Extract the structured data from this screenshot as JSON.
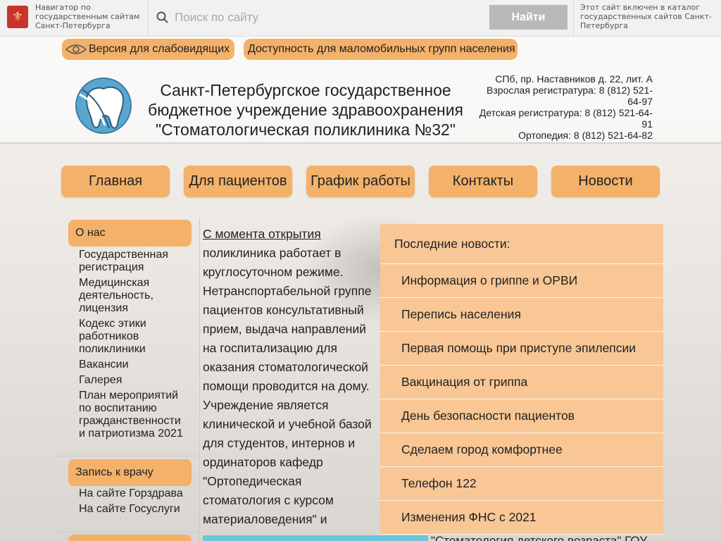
{
  "govbar": {
    "navigator_text": "Навигатор по государственным сайтам Санкт-Петербурга",
    "search_placeholder": "Поиск по сайту",
    "search_button": "Найти",
    "catalog_text": "Этот сайт включен в каталог государственных сайтов Санкт-Петербурга"
  },
  "accessibility": {
    "vision_label": "Версия для слабовидящих",
    "mobility_label": "Доступность для маломобильных групп населения"
  },
  "header": {
    "org_line1": "Санкт-Петербургское государственное",
    "org_line2": "бюджетное учреждение здравоохранения",
    "org_line3": "\"Стоматологическая поликлиника №32\"",
    "address": "СПб, пр. Наставников д. 22, лит. А",
    "adult_reg": "Взрослая регистратура: 8 (812) 521-64-97",
    "child_reg": "Детская регистратура: 8 (812) 521-64-91",
    "ortho": "Ортопедия: 8 (812) 521-64-82"
  },
  "nav": [
    "Главная",
    "Для пациентов",
    "График работы",
    "Контакты",
    "Новости"
  ],
  "sidebar": {
    "about_head": "О нас",
    "about_links": [
      "Государственная регистрация",
      "Медицинская деятельность, лицензия",
      "Кодекс этики работников поликлиники",
      "Вакансии",
      "Галерея",
      "План мероприятий по воспитанию гражданственности и патриотизма 2021"
    ],
    "appointment_head": "Запись к врачу",
    "appointment_links": [
      "На сайте Горздрава",
      "На сайте Госуслуги"
    ]
  },
  "main": {
    "lead": "С момента открытия",
    "body": "поликлиника работает в круглосуточном режиме. Нетранспортабельной группе пациентов консультативный прием, выдача направлений на госпитализацию для оказания стоматологической помощи проводится на дому. Учреждение является клинической и учебной базой для студентов, интернов и ординаторов кафедр \"Ортопедическая стоматология с курсом материаловедения\" и",
    "tail": "\"Стоматология детского возраста\" ГОУ"
  },
  "news": {
    "title": "Последние новости:",
    "items": [
      "Информация о гриппе и ОРВИ",
      "Перепись населения",
      "Первая помощь при приступе эпилепсии",
      "Вакцинация от гриппа",
      "День безопасности пациентов",
      "Сделаем город комфортнее",
      "Телефон 122",
      "Изменения ФНС с 2021"
    ]
  },
  "colors": {
    "accent": "#f3b16a",
    "news_bg": "#f8c795",
    "gov_red": "#c8332c"
  }
}
